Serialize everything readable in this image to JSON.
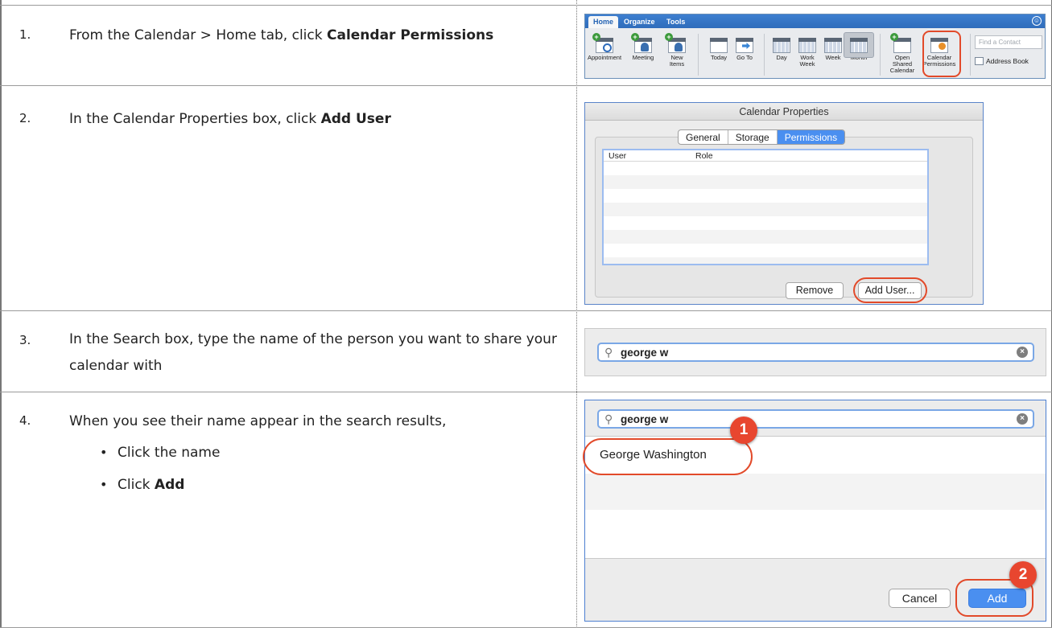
{
  "steps": [
    {
      "num": "1.",
      "text_before": "From the Calendar > Home tab, click ",
      "bold": "Calendar Permissions"
    },
    {
      "num": "2.",
      "text_before": "In the Calendar Properties box, click ",
      "bold": "Add User"
    },
    {
      "num": "3.",
      "text": "In the Search box, type the name of the person you want to share your calendar with"
    },
    {
      "num": "4.",
      "text": "When you see their name appear in the search results,",
      "bullet1": "Click the name",
      "bullet2_before": "Click ",
      "bullet2_bold": "Add"
    }
  ],
  "ribbon": {
    "tabs": [
      "Home",
      "Organize",
      "Tools"
    ],
    "buttons": {
      "appointment": "Appointment",
      "meeting": "Meeting",
      "new_items": "New\nItems",
      "today": "Today",
      "go_to": "Go To",
      "day": "Day",
      "work_week": "Work\nWeek",
      "week": "Week",
      "month": "Month",
      "open_shared_calendar": "Open Shared\nCalendar",
      "calendar_permissions": "Calendar\nPermissions"
    },
    "find_contact_placeholder": "Find a Contact",
    "address_book": "Address Book"
  },
  "calendar_properties": {
    "title": "Calendar Properties",
    "tabs": [
      "General",
      "Storage",
      "Permissions"
    ],
    "columns": [
      "User",
      "Role"
    ],
    "remove_button": "Remove",
    "add_user_button": "Add User..."
  },
  "search": {
    "query": "george w"
  },
  "add_dialog": {
    "query": "george w",
    "result": "George Washington",
    "cancel_button": "Cancel",
    "add_button": "Add",
    "callout_1": "1",
    "callout_2": "2"
  },
  "colors": {
    "ribbon_blue": "#2f6cbb",
    "selection_blue": "#4a8ff0",
    "annotation_red": "#e24a2a"
  }
}
